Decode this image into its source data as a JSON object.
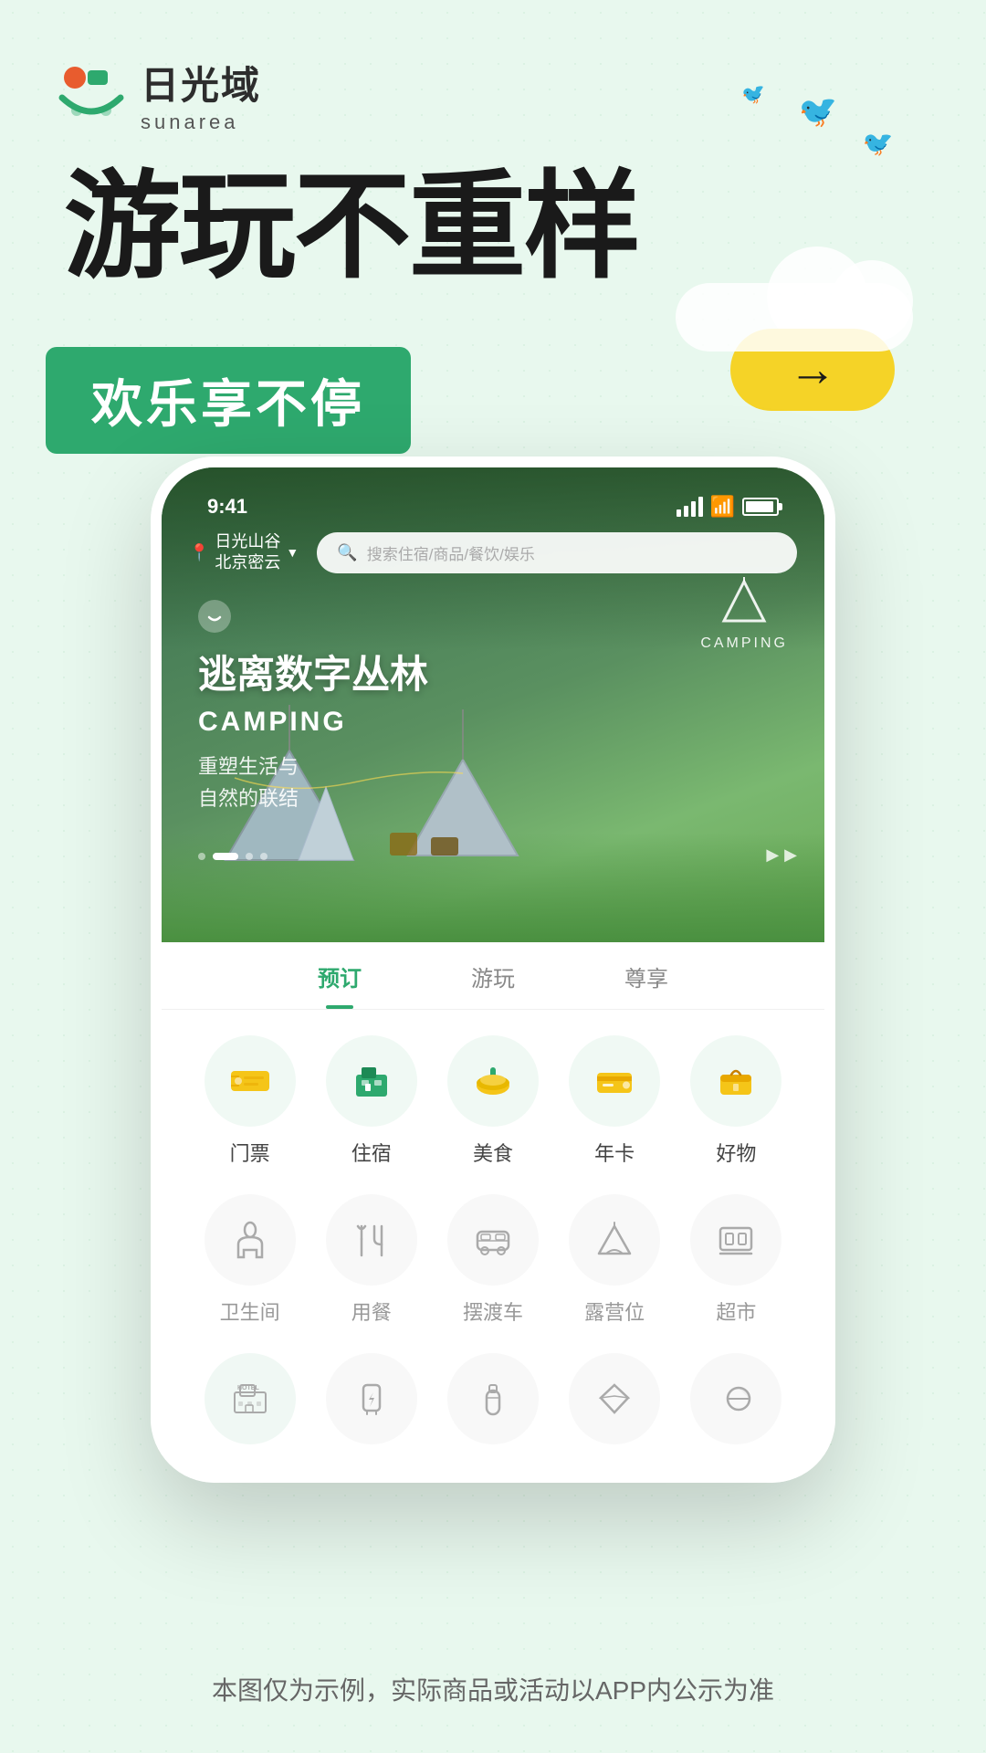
{
  "logo": {
    "chinese": "日光域",
    "english": "sunarea"
  },
  "hero": {
    "title": "游玩不重样",
    "banner_text": "欢乐享不停",
    "arrow": "→"
  },
  "status_bar": {
    "time": "9:41"
  },
  "location": {
    "line1": "日光山谷",
    "line2": "北京密云"
  },
  "search": {
    "placeholder": "搜索住宿/商品/餐饮/娱乐"
  },
  "banner": {
    "title_cn": "逃离数字丛林",
    "title_en": "CAMPING",
    "subtitle_line1": "重塑生活与",
    "subtitle_line2": "自然的联结",
    "camping_label": "CAMPING"
  },
  "tabs": [
    {
      "label": "预订",
      "active": true
    },
    {
      "label": "游玩",
      "active": false
    },
    {
      "label": "尊享",
      "active": false
    }
  ],
  "icon_row1": [
    {
      "label": "门票",
      "emoji": "🎫",
      "color": "#f0f9f4"
    },
    {
      "label": "住宿",
      "emoji": "🏨",
      "color": "#f0f9f4"
    },
    {
      "label": "美食",
      "emoji": "🍽️",
      "color": "#f0f9f4"
    },
    {
      "label": "年卡",
      "emoji": "💳",
      "color": "#f0f9f4"
    },
    {
      "label": "好物",
      "emoji": "🛍️",
      "color": "#f0f9f4"
    }
  ],
  "icon_row2": [
    {
      "label": "卫生间",
      "icon": "🚽"
    },
    {
      "label": "用餐",
      "icon": "🍴"
    },
    {
      "label": "摆渡车",
      "icon": "🚌"
    },
    {
      "label": "露营位",
      "icon": "⛺"
    },
    {
      "label": "超市",
      "icon": "🖥️"
    }
  ],
  "icon_row3": [
    {
      "label": "HOTEL",
      "icon": "🏨"
    },
    {
      "label": "",
      "icon": "🔌"
    },
    {
      "label": "",
      "icon": "🧴"
    },
    {
      "label": "",
      "icon": "💎"
    },
    {
      "label": "",
      "icon": "💊"
    }
  ],
  "footer": {
    "text": "本图仅为示例，实际商品或活动以APP内公示为准"
  },
  "carousel": {
    "dots": [
      false,
      true,
      false,
      false
    ],
    "arrows": "▶ ▶"
  }
}
